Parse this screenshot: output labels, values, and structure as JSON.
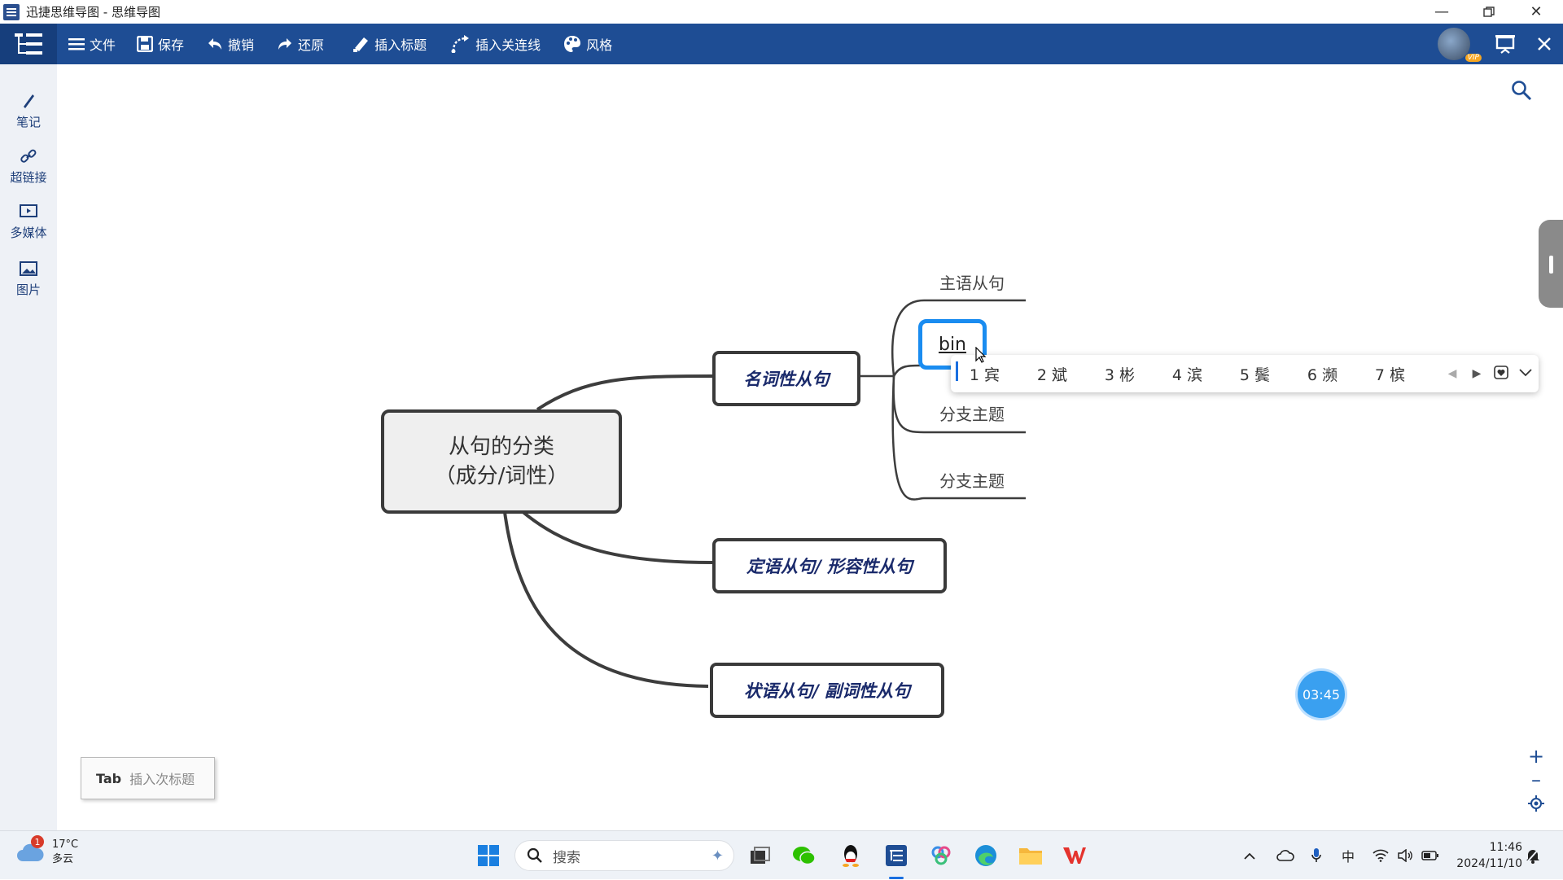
{
  "window": {
    "title": "迅捷思维导图 - 思维导图"
  },
  "toolbar": {
    "items": [
      "文件",
      "保存",
      "撤销",
      "还原",
      "插入标题",
      "插入关连线",
      "风格"
    ],
    "vip_badge": "VIP"
  },
  "sidebar": {
    "items": [
      "笔记",
      "超链接",
      "多媒体",
      "图片"
    ]
  },
  "mindmap": {
    "root_line1": "从句的分类",
    "root_line2": "（成分/词性）",
    "main_nodes": [
      "名词性从句",
      "定语从句/ 形容性从句",
      "状语从句/ 副词性从句"
    ],
    "sub_nodes": [
      "主语从句",
      "分支主题",
      "分支主题"
    ],
    "editing_text": "bin"
  },
  "ime": {
    "candidates": [
      "1 宾",
      "2 斌",
      "3 彬",
      "4 滨",
      "5 鬓",
      "6 濒",
      "7 槟"
    ]
  },
  "timer": "03:45",
  "tab_tip": {
    "key": "Tab",
    "text": "插入次标题"
  },
  "taskbar": {
    "weather_temp": "17°C",
    "weather_desc": "多云",
    "weather_badge": "1",
    "search_placeholder": "搜索",
    "ime_mode": "中",
    "time": "11:46",
    "date": "2024/11/10"
  }
}
